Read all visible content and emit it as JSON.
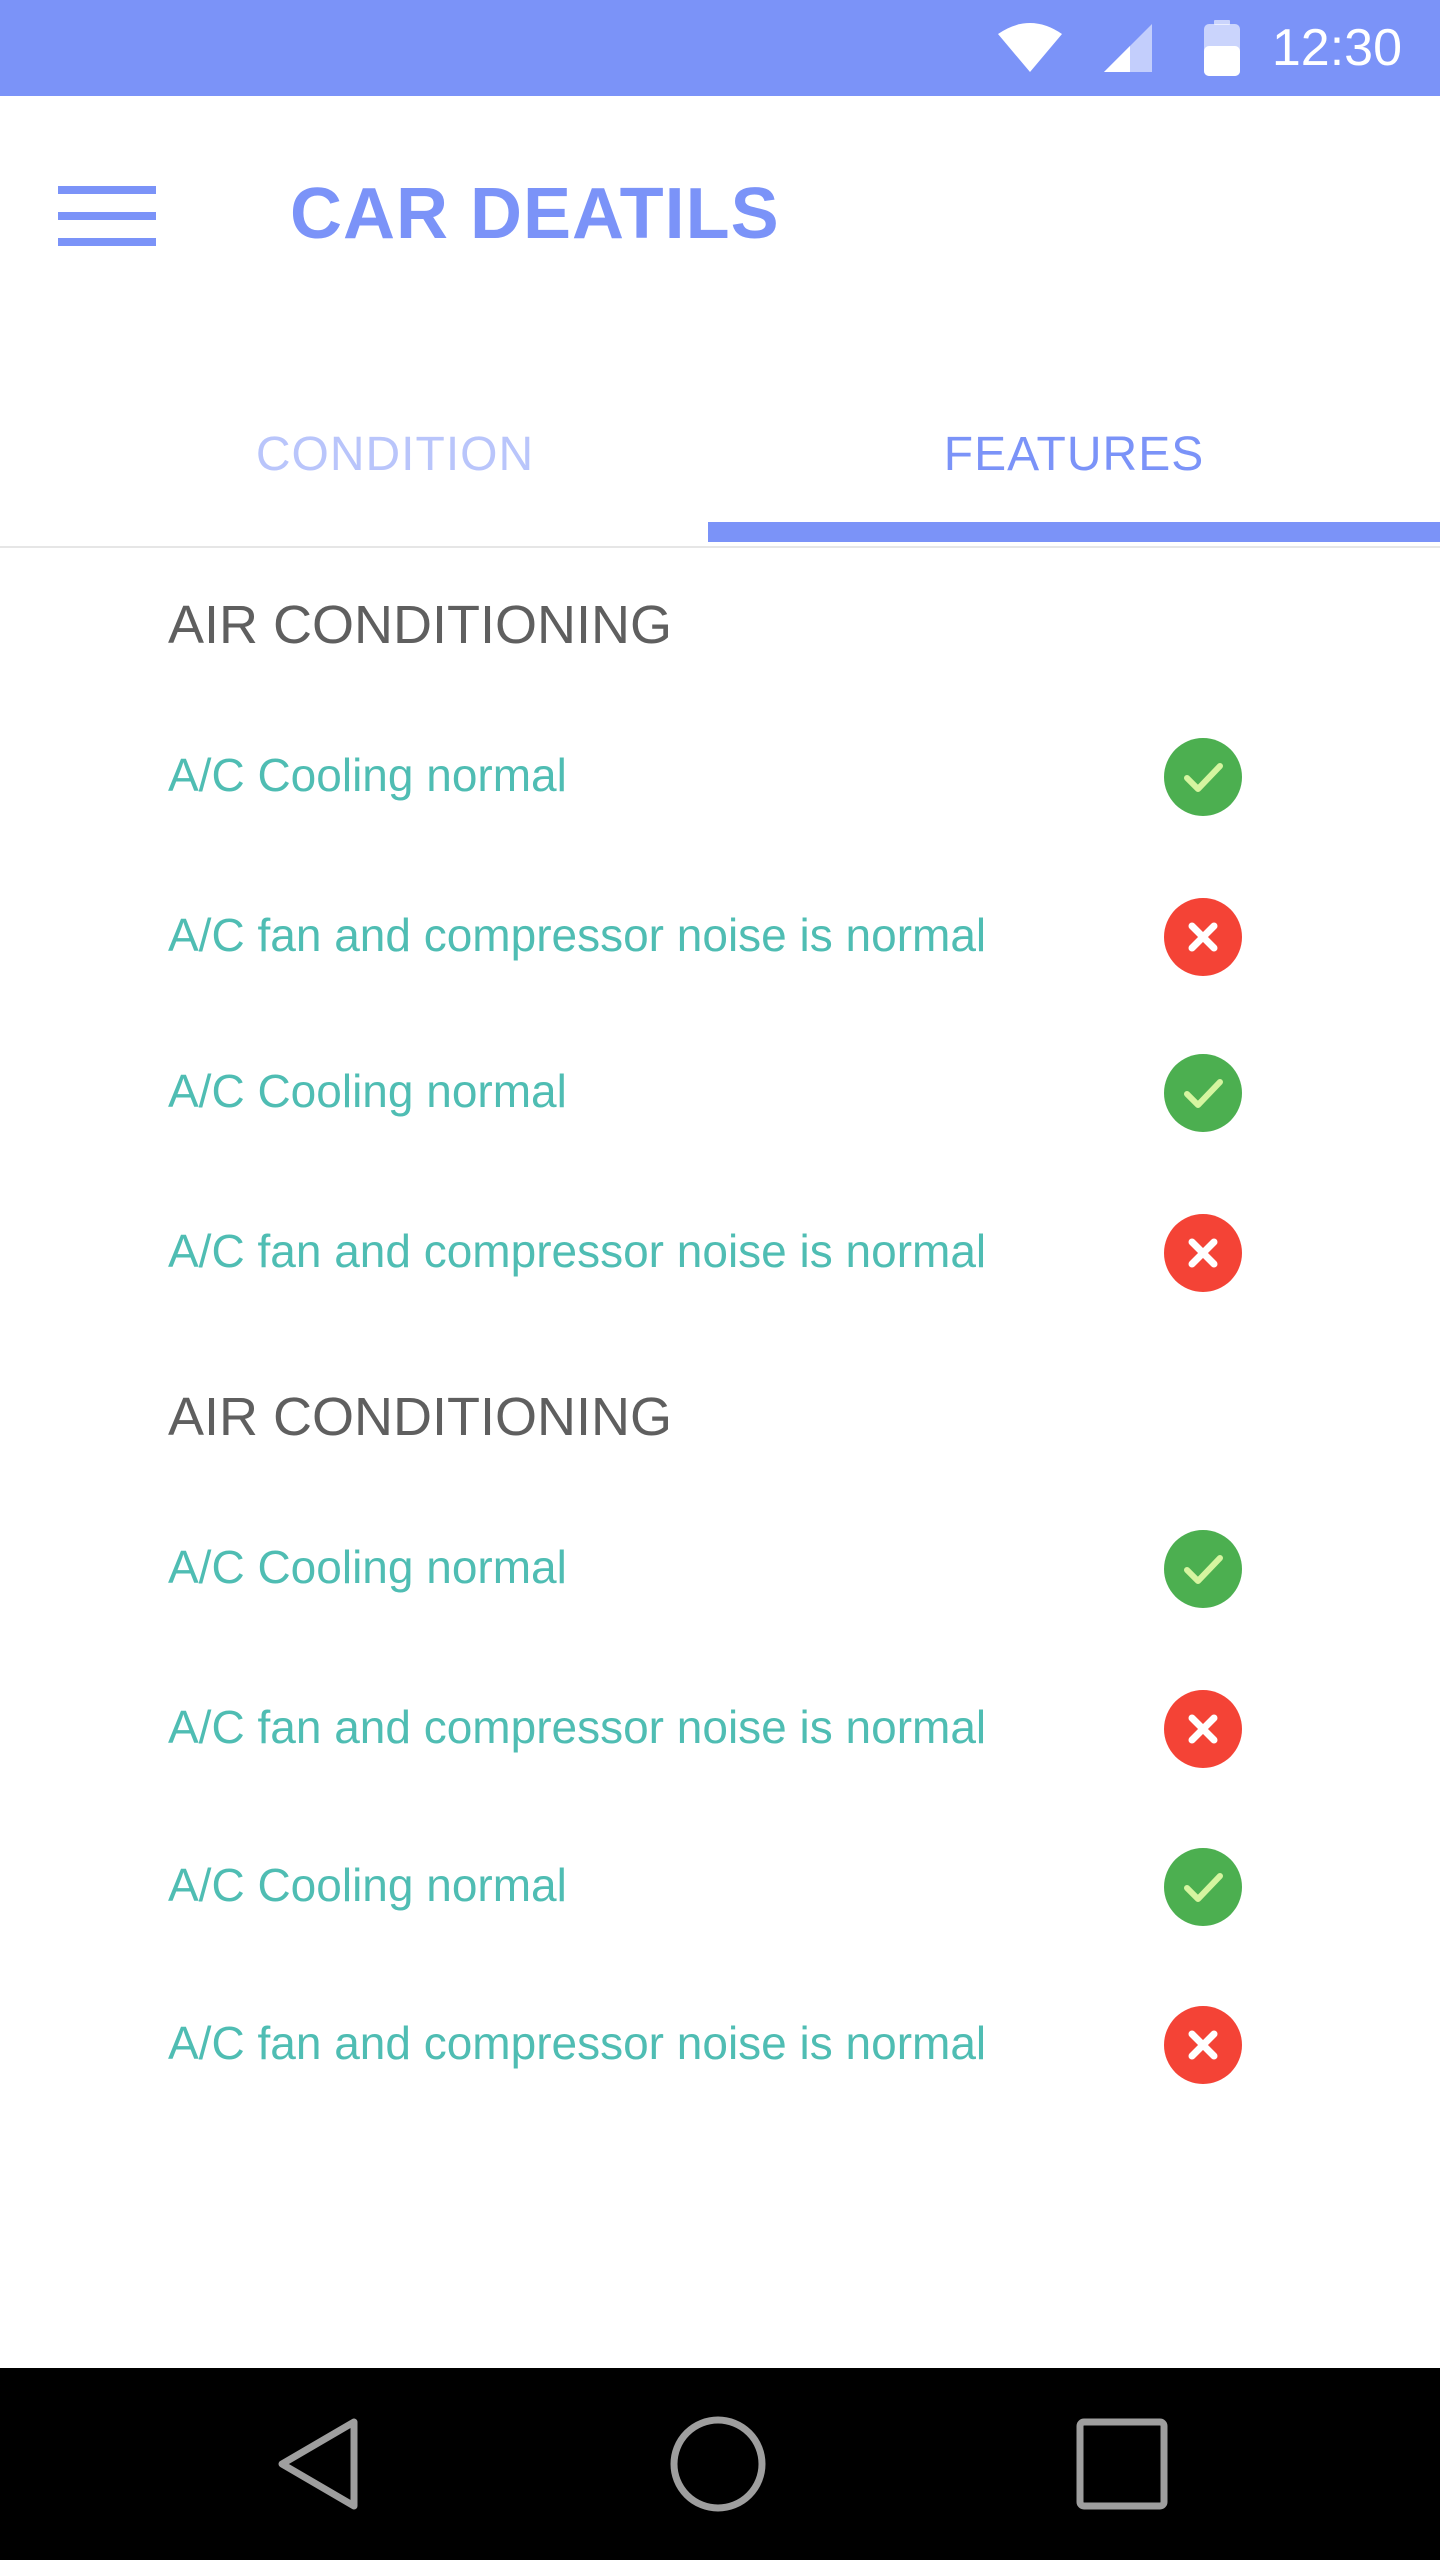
{
  "status_bar": {
    "time": "12:30",
    "icons": [
      "wifi-icon",
      "cell-signal-icon",
      "battery-icon"
    ],
    "background": "#7b93f8"
  },
  "app_bar": {
    "title": "CAR DEATILS",
    "menu_icon": "hamburger-menu-icon"
  },
  "tabs": [
    {
      "label": "CONDITION",
      "selected": false
    },
    {
      "label": "FEATURES",
      "selected": true
    }
  ],
  "sections": [
    {
      "heading": "AIR CONDITIONING",
      "items": [
        {
          "label": "A/C Cooling normal",
          "status": "pass",
          "icon": "check-circle-icon"
        },
        {
          "label": "A/C fan and compressor noise is normal",
          "status": "fail",
          "icon": "x-circle-icon"
        },
        {
          "label": "A/C Cooling normal",
          "status": "pass",
          "icon": "check-circle-icon"
        },
        {
          "label": "A/C fan and compressor noise is normal",
          "status": "fail",
          "icon": "x-circle-icon"
        }
      ]
    },
    {
      "heading": "AIR CONDITIONING",
      "items": [
        {
          "label": "A/C Cooling normal",
          "status": "pass",
          "icon": "check-circle-icon"
        },
        {
          "label": "A/C fan and compressor noise is normal",
          "status": "fail",
          "icon": "x-circle-icon"
        },
        {
          "label": "A/C Cooling normal",
          "status": "pass",
          "icon": "check-circle-icon"
        },
        {
          "label": "A/C fan and compressor noise is normal",
          "status": "fail",
          "icon": "x-circle-icon"
        }
      ]
    }
  ],
  "colors": {
    "accent": "#7b93f8",
    "accent_light": "#b9c5fb",
    "item_text": "#4fbdb3",
    "heading_text": "#5f5f5f",
    "pass": "#4caf50",
    "fail": "#f44336"
  },
  "nav_bar": {
    "buttons": [
      "back-icon",
      "home-icon",
      "recents-icon"
    ]
  }
}
